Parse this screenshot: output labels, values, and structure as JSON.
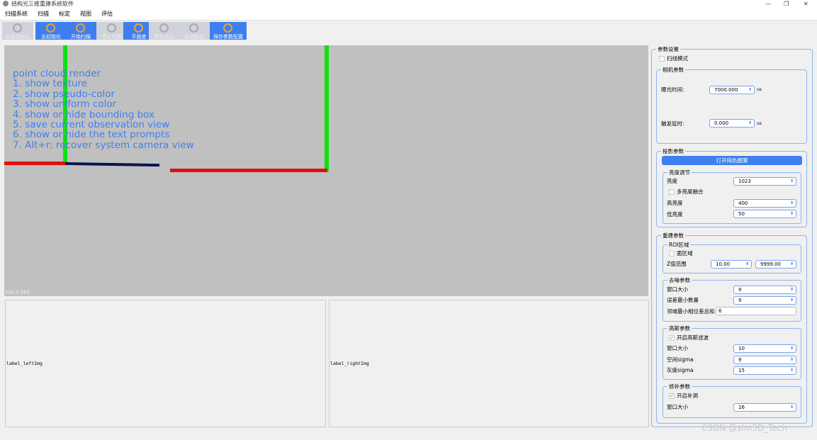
{
  "window": {
    "title": "结构光三维重建系统软件",
    "controls": [
      "—",
      "❐",
      "✕"
    ]
  },
  "menu": [
    "扫描系统",
    "扫描",
    "标定",
    "视图",
    "评估"
  ],
  "toolbar": [
    {
      "label": "扫描初始化",
      "enabled": false,
      "icon": "refresh-icon"
    },
    {
      "label": "去初始化",
      "enabled": true,
      "icon": "deinit-icon"
    },
    {
      "label": "开始扫描",
      "enabled": true,
      "icon": "play-icon"
    },
    {
      "label": "停止扫描",
      "enabled": false,
      "icon": "stop-icon"
    },
    {
      "label": "平面度",
      "enabled": true,
      "icon": "flatness-icon"
    },
    {
      "label": "保存点云",
      "enabled": false,
      "icon": "download-icon"
    },
    {
      "label": "系统标定",
      "enabled": false,
      "icon": "grid-icon"
    },
    {
      "label": "保存参数配置",
      "enabled": true,
      "icon": "settings-sliders-icon"
    }
  ],
  "viewport": {
    "lines": [
      "point cloud render",
      "1. show texture",
      "2. show pseudo-color",
      "3. show uniform color",
      "4. show or hide bounding box",
      "5. save current observation view",
      "6. show or hide the text prompts",
      " 7. Alt+r: recover system camera view"
    ],
    "fps": "250.0 FPS"
  },
  "images": {
    "left": "label_leftImg",
    "right": "label_rightImg"
  },
  "params": {
    "title": "参数设置",
    "scan_mode": "扫线模式",
    "camera": {
      "title": "相机参数",
      "exposure_label": "曝光时间:",
      "exposure": "7000.000",
      "unit": "us",
      "delay_label": "触发延时:",
      "delay": "0.000"
    },
    "projection": {
      "title": "投影参数",
      "button": "打开纯色图案",
      "brightness_group": "亮度调节",
      "brightness_label": "亮度",
      "brightness": "1023",
      "multi": "多亮度融合",
      "high_label": "高亮度",
      "high": "400",
      "low_label": "低亮度",
      "low": "50"
    },
    "recon": {
      "title": "重建参数",
      "roi": "ROI区域",
      "area": "面区域",
      "z_label": "Z值范围",
      "z_min": "10.00",
      "z_max": "9999.00",
      "denoise": "去噪参数",
      "win_label": "窗口大小",
      "win": "9",
      "err_label": "误差最小数量",
      "err": "9",
      "phase_label": "邻域最小相位差总和",
      "phase": "6",
      "gauss": "高斯参数",
      "gauss_enable": "开启高斯滤波",
      "gwin_label": "窗口大小",
      "gwin": "10",
      "space_label": "空间sigma",
      "space": "9",
      "gray_label": "灰度sigma",
      "gray": "15",
      "repair": "修补参数",
      "repair_enable": "开启补洞",
      "rwin_label": "窗口大小",
      "rwin": "16"
    }
  },
  "watermark": "CSDN @slm3D_Tech"
}
